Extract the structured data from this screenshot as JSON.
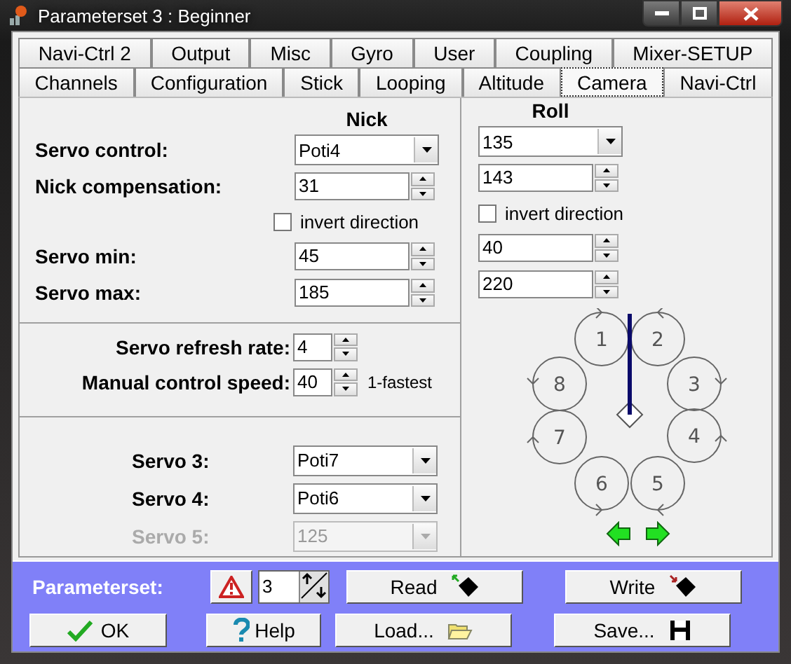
{
  "window": {
    "title": "Parameterset 3 : Beginner"
  },
  "tabs": [
    [
      {
        "label": "Navi-Ctrl 2",
        "selected": false
      },
      {
        "label": "Output",
        "selected": false
      },
      {
        "label": "Misc",
        "selected": false
      },
      {
        "label": "Gyro",
        "selected": false
      },
      {
        "label": "User",
        "selected": false
      },
      {
        "label": "Coupling",
        "selected": false
      },
      {
        "label": "Mixer-SETUP",
        "selected": false
      }
    ],
    [
      {
        "label": "Channels",
        "selected": false
      },
      {
        "label": "Configuration",
        "selected": false
      },
      {
        "label": "Stick",
        "selected": false
      },
      {
        "label": "Looping",
        "selected": false
      },
      {
        "label": "Altitude",
        "selected": false
      },
      {
        "label": "Camera",
        "selected": true
      },
      {
        "label": "Navi-Ctrl",
        "selected": false
      }
    ]
  ],
  "columns": [
    "Nick",
    "Roll"
  ],
  "servo_settings": [
    {
      "kind": "dropdown",
      "label": "Servo control:",
      "nick": "Poti4",
      "roll": "135"
    },
    {
      "kind": "spinner",
      "label": "Nick compensation:",
      "nick": "31",
      "roll": "143"
    },
    {
      "kind": "checkbox",
      "nick": {
        "label": "invert direction",
        "checked": false
      },
      "roll": {
        "label": "invert direction",
        "checked": false
      }
    },
    {
      "kind": "spinner",
      "label": "Servo min:",
      "nick": "45",
      "roll": "40"
    },
    {
      "kind": "spinner",
      "label": "Servo max:",
      "nick": "185",
      "roll": "220"
    }
  ],
  "timing": [
    {
      "label": "Servo refresh rate:",
      "value": "4"
    },
    {
      "label": "Manual control speed:",
      "value": "40",
      "hint": "1-fastest"
    }
  ],
  "extra_servos": [
    {
      "label": "Servo 3:",
      "value": "Poti7",
      "disabled": false
    },
    {
      "label": "Servo 4:",
      "value": "Poti6",
      "disabled": false
    },
    {
      "label": "Servo 5:",
      "value": "125",
      "disabled": true
    }
  ],
  "rotors": [
    "1",
    "2",
    "3",
    "4",
    "5",
    "6",
    "7",
    "8"
  ],
  "bottom": {
    "label": "Parameterset:",
    "value": "3",
    "buttons": [
      [
        "Read",
        "Write"
      ],
      [
        "OK",
        "Help",
        "Load...",
        "Save..."
      ]
    ]
  }
}
